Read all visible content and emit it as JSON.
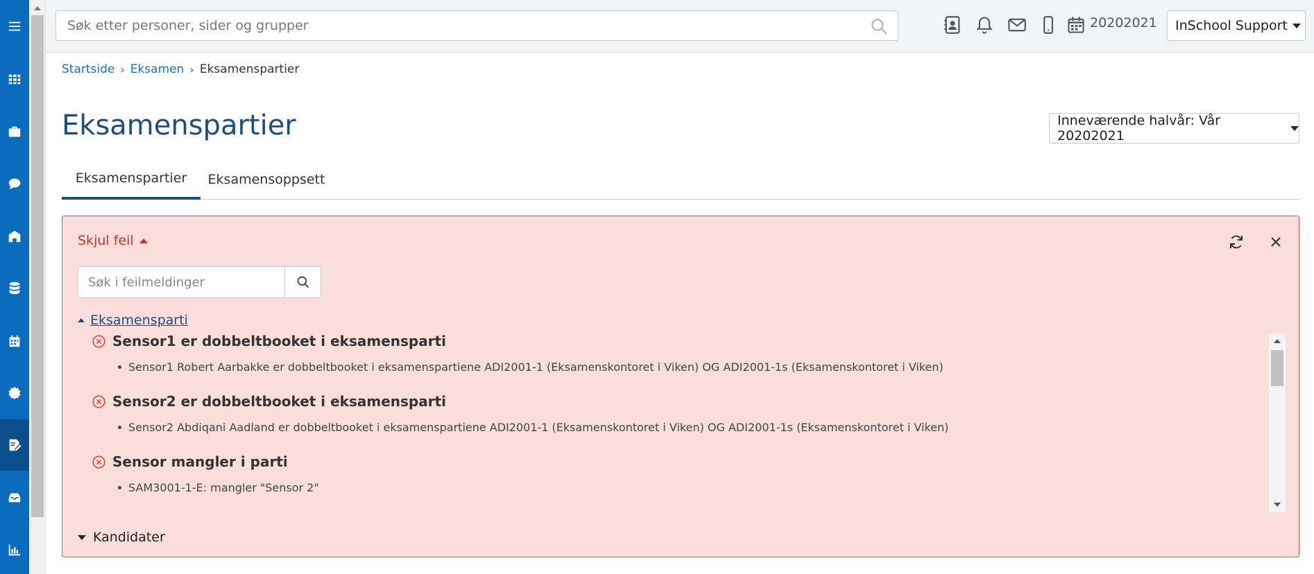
{
  "colors": {
    "rail": "#0b6cbd",
    "rail_active": "#0a4f8c",
    "title": "#1a4f7f",
    "link": "#1f6fb8",
    "error_bg": "#f9dedc",
    "error_border": "#d9534f",
    "error_text": "#c0392b"
  },
  "sidebar": {
    "items": [
      {
        "icon": "menu-icon"
      },
      {
        "icon": "grid-icon"
      },
      {
        "icon": "briefcase-icon"
      },
      {
        "icon": "chat-icon"
      },
      {
        "icon": "school-icon"
      },
      {
        "icon": "database-icon"
      },
      {
        "icon": "calendar-icon"
      },
      {
        "icon": "badge-icon"
      },
      {
        "icon": "edit-document-icon",
        "active": true
      },
      {
        "icon": "inbox-icon"
      },
      {
        "icon": "bar-chart-icon"
      }
    ]
  },
  "header": {
    "search_placeholder": "Søk etter personer, sider og grupper",
    "year": "20202021",
    "user": "InSchool Support",
    "icons": [
      "contact-card-icon",
      "bell-icon",
      "mail-icon",
      "mobile-icon",
      "calendar-icon"
    ]
  },
  "breadcrumb": {
    "items": [
      "Startside",
      "Eksamen"
    ],
    "current": "Eksamenspartier"
  },
  "page": {
    "title": "Eksamenspartier",
    "semester": "Inneværende halvår: Vår 20202021"
  },
  "tabs": [
    {
      "label": "Eksamenspartier",
      "active": true
    },
    {
      "label": "Eksamensoppsett",
      "active": false
    }
  ],
  "errors": {
    "toggle_label": "Skjul feil",
    "search_placeholder": "Søk i feilmeldinger",
    "groups": [
      {
        "label": "Eksamensparti",
        "expanded": true,
        "items": [
          {
            "title": "Sensor1 er dobbeltbooket i eksamensparti",
            "detail": "Sensor1 Robert Aarbakke er dobbeltbooket i eksamenspartiene ADI2001-1 (Eksamenskontoret i Viken) OG ADI2001-1s (Eksamenskontoret i Viken)"
          },
          {
            "title": "Sensor2 er dobbeltbooket i eksamensparti",
            "detail": "Sensor2 Abdiqani Aadland er dobbeltbooket i eksamenspartiene ADI2001-1 (Eksamenskontoret i Viken) OG ADI2001-1s (Eksamenskontoret i Viken)"
          },
          {
            "title": "Sensor mangler i parti",
            "detail": "SAM3001-1-E: mangler \"Sensor 2\""
          }
        ]
      },
      {
        "label": "Kandidater",
        "expanded": false
      }
    ]
  }
}
